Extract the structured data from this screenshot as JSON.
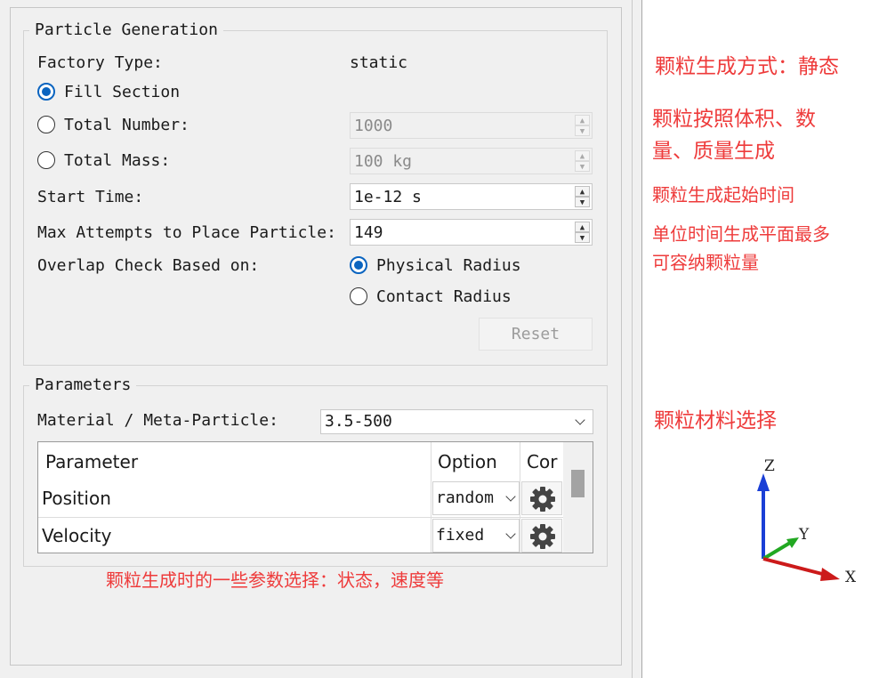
{
  "particle_generation": {
    "title": "Particle Generation",
    "factory_type_label": "Factory Type:",
    "factory_type_value": "static",
    "fill_section_label": "Fill Section",
    "total_number_label": "Total Number:",
    "total_number_value": "1000",
    "total_mass_label": "Total Mass:",
    "total_mass_value": "100 kg",
    "start_time_label": "Start Time:",
    "start_time_value": "1e-12 s",
    "max_attempts_label": "Max Attempts to Place Particle:",
    "max_attempts_value": "149",
    "overlap_label": "Overlap Check Based on:",
    "physical_radius_label": "Physical Radius",
    "contact_radius_label": "Contact Radius",
    "reset_label": "Reset",
    "selected_mode": "Fill Section",
    "selected_overlap": "Physical Radius"
  },
  "parameters": {
    "title": "Parameters",
    "material_label": "Material / Meta-Particle:",
    "material_value": "3.5-500",
    "table": {
      "headers": [
        "Parameter",
        "Option",
        "Cor"
      ],
      "rows": [
        {
          "parameter": "Position",
          "option": "random"
        },
        {
          "parameter": "Velocity",
          "option": "fixed"
        }
      ]
    }
  },
  "annotations": {
    "factory_type": "颗粒生成方式：静态",
    "fill_modes_line1": "颗粒按照体积、数",
    "fill_modes_line2": "量、质量生成",
    "start_time": "颗粒生成起始时间",
    "max_attempts_line1": "单位时间生成平面最多",
    "max_attempts_line2": "可容纳颗粒量",
    "material": "颗粒材料选择",
    "parameters": "颗粒生成时的一些参数选择：状态，速度等"
  },
  "axes": {
    "z": "Z",
    "y": "Y",
    "x": "X"
  },
  "colors": {
    "annotation": "#ee3b3b",
    "radio_selected": "#0a64c0",
    "axis_z": "#1a3fd6",
    "axis_y": "#22a822",
    "axis_x": "#cc1a1a"
  }
}
